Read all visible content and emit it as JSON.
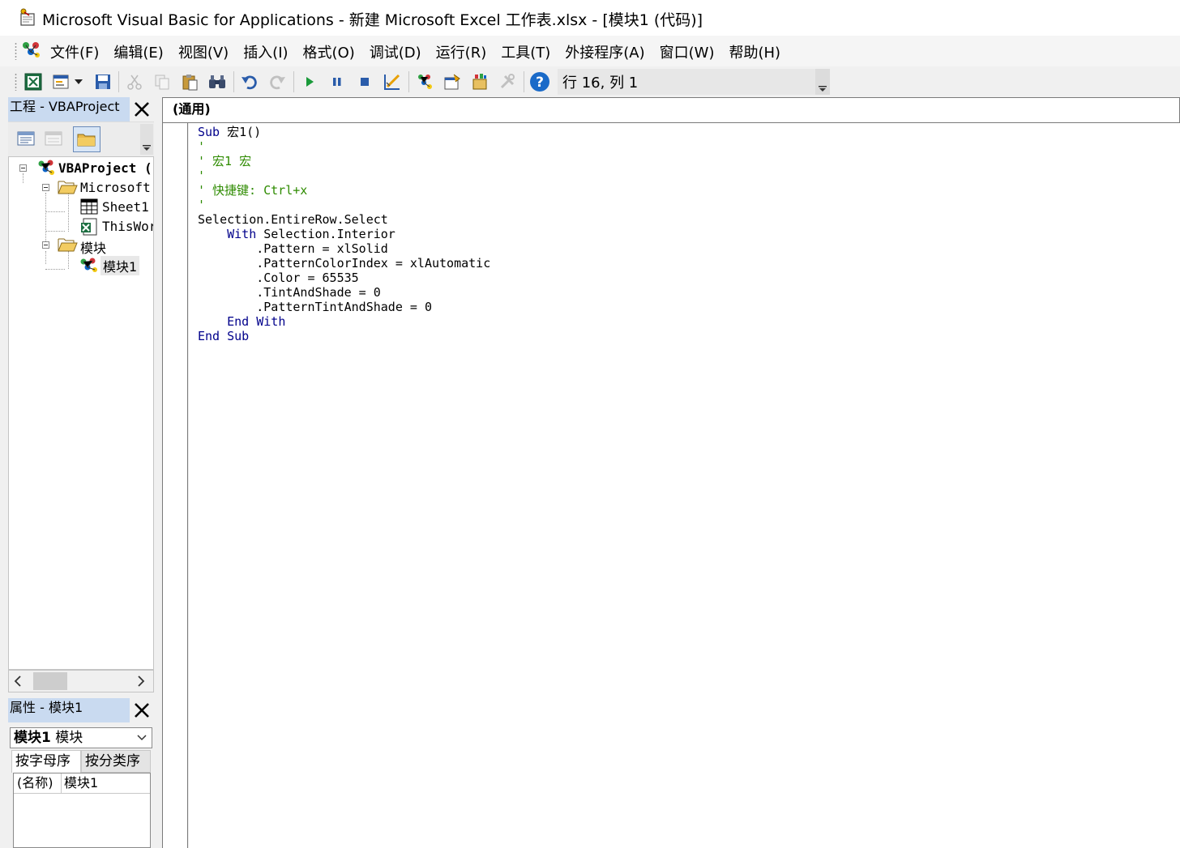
{
  "window": {
    "title": "Microsoft Visual Basic for Applications - 新建 Microsoft Excel 工作表.xlsx - [模块1 (代码)]"
  },
  "menu": {
    "items": [
      "文件(F)",
      "编辑(E)",
      "视图(V)",
      "插入(I)",
      "格式(O)",
      "调试(D)",
      "运行(R)",
      "工具(T)",
      "外接程序(A)",
      "窗口(W)",
      "帮助(H)"
    ]
  },
  "toolbar": {
    "position_text": "行 16, 列 1"
  },
  "project_explorer": {
    "title": "工程 - VBAProject",
    "tree": {
      "root": "VBAProject (",
      "microsoft_folder": "Microsoft",
      "sheet1": "Sheet1",
      "thisworkbook": "ThisWor",
      "modules_folder": "模块",
      "module1": "模块1"
    }
  },
  "properties": {
    "title": "属性 - 模块1",
    "selected_object_name": "模块1",
    "selected_object_type": "模块",
    "tabs": [
      "按字母序",
      "按分类序"
    ],
    "rows": [
      {
        "name": "(名称)",
        "value": "模块1"
      }
    ]
  },
  "code_window": {
    "object_combo": "(通用)",
    "lines": [
      {
        "seg": [
          {
            "t": "Sub",
            "c": "kw"
          },
          {
            "t": " 宏1()",
            "c": ""
          }
        ]
      },
      {
        "seg": [
          {
            "t": "'",
            "c": "cm"
          }
        ]
      },
      {
        "seg": [
          {
            "t": "' 宏1 宏",
            "c": "cm"
          }
        ]
      },
      {
        "seg": [
          {
            "t": "'",
            "c": "cm"
          }
        ]
      },
      {
        "seg": [
          {
            "t": "' 快捷键: Ctrl+x",
            "c": "cm"
          }
        ]
      },
      {
        "seg": [
          {
            "t": "'",
            "c": "cm"
          }
        ]
      },
      {
        "seg": [
          {
            "t": "Selection.EntireRow.Select",
            "c": ""
          }
        ]
      },
      {
        "seg": [
          {
            "t": "    ",
            "c": ""
          },
          {
            "t": "With",
            "c": "kw"
          },
          {
            "t": " Selection.Interior",
            "c": ""
          }
        ]
      },
      {
        "seg": [
          {
            "t": "        .Pattern = xlSolid",
            "c": ""
          }
        ]
      },
      {
        "seg": [
          {
            "t": "        .PatternColorIndex = xlAutomatic",
            "c": ""
          }
        ]
      },
      {
        "seg": [
          {
            "t": "        .Color = 65535",
            "c": ""
          }
        ]
      },
      {
        "seg": [
          {
            "t": "        .TintAndShade = 0",
            "c": ""
          }
        ]
      },
      {
        "seg": [
          {
            "t": "        .PatternTintAndShade = 0",
            "c": ""
          }
        ]
      },
      {
        "seg": [
          {
            "t": "    ",
            "c": ""
          },
          {
            "t": "End With",
            "c": "kw"
          }
        ]
      },
      {
        "seg": [
          {
            "t": "End Sub",
            "c": "kw"
          }
        ]
      }
    ]
  }
}
